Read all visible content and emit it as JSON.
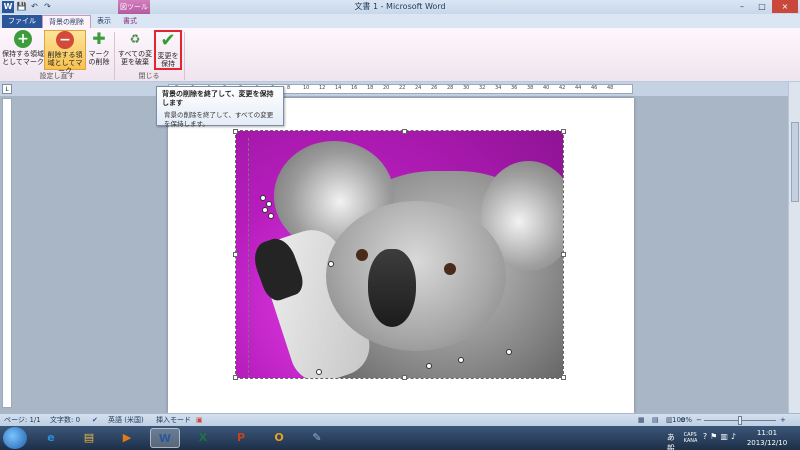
{
  "window": {
    "title": "文書 1 - Microsoft Word",
    "context_tool": "図ツール",
    "app_letter": "W",
    "minimize": "–",
    "maximize": "□",
    "close": "×"
  },
  "qat": [
    "💾",
    "↶",
    "↷"
  ],
  "tabs": [
    {
      "label": "ファイル"
    },
    {
      "label": "背景の削除"
    },
    {
      "label": "表示"
    },
    {
      "label": "書式"
    }
  ],
  "ribbon": {
    "keep_label": "保持する領域としてマーク",
    "remove_label": "削除する領域としてマーク",
    "delete_mark_label": "マークの削除",
    "discard_label": "すべての変更を破棄",
    "keep_changes_label": "変更を保持",
    "group_refine": "設定し直す",
    "group_close": "閉じる"
  },
  "ruler": {
    "ticks": [
      "8",
      "6",
      "4",
      "2",
      "2",
      "4",
      "6",
      "8",
      "10",
      "12",
      "14",
      "16",
      "18",
      "20",
      "22",
      "24",
      "26",
      "28",
      "30",
      "32",
      "34",
      "36",
      "38",
      "40",
      "42",
      "44",
      "46",
      "48"
    ]
  },
  "tooltip": {
    "title": "背景の削除を終了して、変更を保持します",
    "body": "背景の削除を終了して、すべての変更を保持します。"
  },
  "statusbar": {
    "page": "ページ: 1/1",
    "words": "文字数: 0",
    "language": "英語 (米国)",
    "mode": "挿入モード",
    "zoom": "100%",
    "minus": "−",
    "plus": "+"
  },
  "taskbar": {
    "apps": [
      {
        "name": "ie",
        "glyph": "e",
        "color": "#2a8ee0"
      },
      {
        "name": "explorer",
        "glyph": "▤",
        "color": "#e8b84a"
      },
      {
        "name": "media",
        "glyph": "▶",
        "color": "#e07b1a"
      },
      {
        "name": "word",
        "glyph": "W",
        "color": "#2b579a"
      },
      {
        "name": "excel",
        "glyph": "X",
        "color": "#1e7145"
      },
      {
        "name": "powerpoint",
        "glyph": "P",
        "color": "#c4421d"
      },
      {
        "name": "outlook",
        "glyph": "O",
        "color": "#e8a21b"
      },
      {
        "name": "paint",
        "glyph": "✎",
        "color": "#8fb0d6"
      }
    ],
    "ime": "あ 般",
    "caps": "CAPS KANA",
    "time": "11:01",
    "date": "2013/12/10"
  }
}
